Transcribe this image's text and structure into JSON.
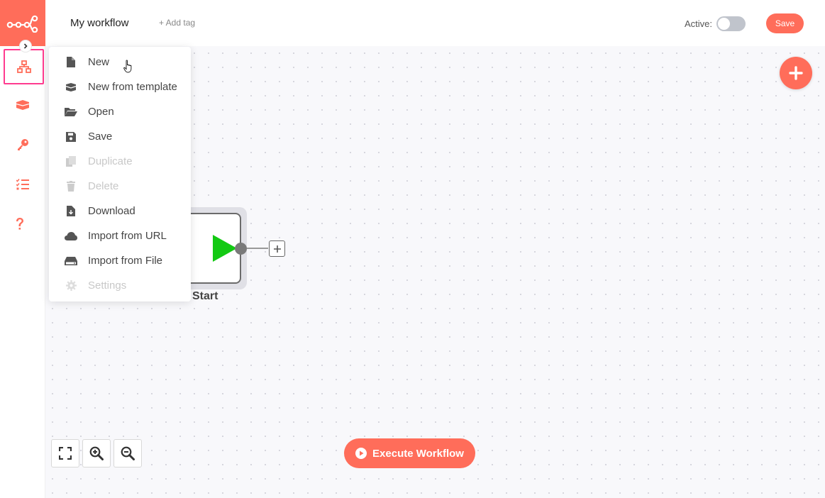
{
  "header": {
    "workflow_name": "My workflow",
    "add_tag": "+ Add tag",
    "active_label": "Active:",
    "active_state": false,
    "save_label": "Save"
  },
  "sidebar": {
    "items": [
      {
        "icon": "network-icon",
        "active": true
      },
      {
        "icon": "box-open-icon"
      },
      {
        "icon": "key-icon"
      },
      {
        "icon": "tasks-list-icon"
      },
      {
        "icon": "question-icon"
      }
    ]
  },
  "menu": {
    "items": [
      {
        "label": "New",
        "icon": "file-icon",
        "enabled": true
      },
      {
        "label": "New from template",
        "icon": "box-open-icon",
        "enabled": true
      },
      {
        "label": "Open",
        "icon": "folder-open-icon",
        "enabled": true
      },
      {
        "label": "Save",
        "icon": "floppy-icon",
        "enabled": true
      },
      {
        "label": "Duplicate",
        "icon": "copy-icon",
        "enabled": false
      },
      {
        "label": "Delete",
        "icon": "trash-icon",
        "enabled": false
      },
      {
        "label": "Download",
        "icon": "file-download-icon",
        "enabled": true
      },
      {
        "label": "Import from URL",
        "icon": "cloud-icon",
        "enabled": true
      },
      {
        "label": "Import from File",
        "icon": "hdd-icon",
        "enabled": true
      },
      {
        "label": "Settings",
        "icon": "cog-icon",
        "enabled": false
      }
    ]
  },
  "node": {
    "label": "Start"
  },
  "footer": {
    "execute_label": "Execute Workflow"
  },
  "colors": {
    "brand": "#ff6d5a",
    "node_play": "#13c913",
    "active_outline": "#ff3b8f"
  }
}
